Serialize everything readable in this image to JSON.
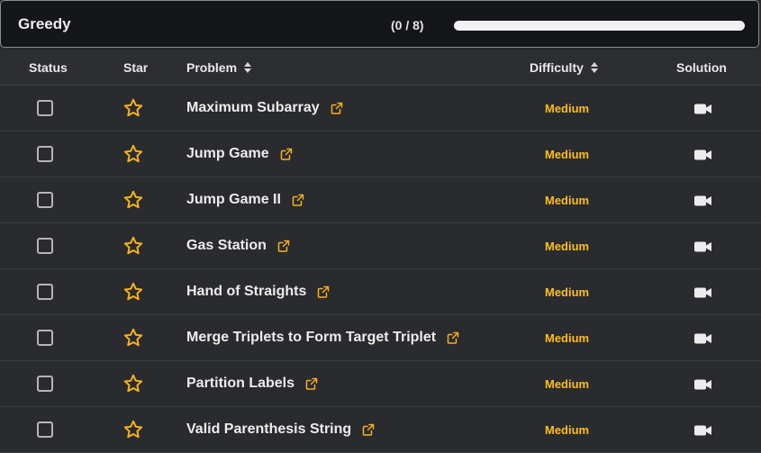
{
  "section": {
    "title": "Greedy",
    "progress_text": "(0 / 8)",
    "progress_fraction": 0
  },
  "table": {
    "headers": {
      "status": "Status",
      "star": "Star",
      "problem": "Problem",
      "difficulty": "Difficulty",
      "solution": "Solution"
    },
    "rows": [
      {
        "problem": "Maximum Subarray",
        "difficulty": "Medium"
      },
      {
        "problem": "Jump Game",
        "difficulty": "Medium"
      },
      {
        "problem": "Jump Game II",
        "difficulty": "Medium"
      },
      {
        "problem": "Gas Station",
        "difficulty": "Medium"
      },
      {
        "problem": "Hand of Straights",
        "difficulty": "Medium"
      },
      {
        "problem": "Merge Triplets to Form Target Triplet",
        "difficulty": "Medium"
      },
      {
        "problem": "Partition Labels",
        "difficulty": "Medium"
      },
      {
        "problem": "Valid Parenthesis String",
        "difficulty": "Medium"
      }
    ]
  },
  "icons": {
    "star": "star-outline-icon",
    "external_link": "external-link-icon",
    "solution": "video-camera-icon",
    "sort": "sort-icon"
  },
  "colors": {
    "accent_star": "#f5b21a",
    "difficulty_medium": "#ffbe1a",
    "header_bg": "#141619",
    "table_bg": "#2a2b2e"
  }
}
